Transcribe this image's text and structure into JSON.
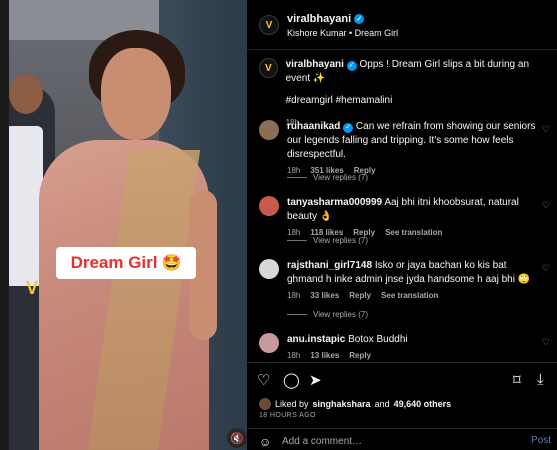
{
  "post": {
    "username": "viralbhayani",
    "audio": "Kishore Kumar • Dream Girl",
    "overlay_text": "Dream Girl",
    "overlay_emoji": "🤩"
  },
  "caption": {
    "username": "viralbhayani",
    "text": "Opps ! Dream Girl slips a bit during an event ✨",
    "hashtags": "#dreamgirl #hemamalini",
    "age": "18h"
  },
  "comments": [
    {
      "username": "ruhaanikad",
      "verified": true,
      "text": "Can we refrain from showing our seniors our legends falling and tripping. It's some how feels disrespectful.",
      "age": "18h",
      "likes": "351 likes",
      "reply": "Reply",
      "see_translation": "",
      "view_replies": "View replies (7)",
      "avatar_color": "#8b6e53"
    },
    {
      "username": "tanyasharma000999",
      "verified": false,
      "text": "Aaj bhi itni khoobsurat, natural beauty 👌",
      "age": "18h",
      "likes": "118 likes",
      "reply": "Reply",
      "see_translation": "See translation",
      "view_replies": "View replies (7)",
      "avatar_color": "#c65a4e"
    },
    {
      "username": "rajsthani_girl7148",
      "verified": false,
      "text": "Isko or jaya bachan ko kis bat ghmand h inke admin jnse jyda handsome h aaj bhi 🙄",
      "age": "18h",
      "likes": "33 likes",
      "reply": "Reply",
      "see_translation": "See translation",
      "view_replies": "View replies (7)",
      "avatar_color": "#d8d8dc"
    },
    {
      "username": "anu.instapic",
      "verified": false,
      "text": "Botox Buddhi",
      "age": "18h",
      "likes": "13 likes",
      "reply": "Reply",
      "see_translation": "",
      "view_replies": "",
      "avatar_color": "#c99a9a"
    }
  ],
  "engagement": {
    "liked_by_prefix": "Liked by",
    "liked_by_user": "singhakshara",
    "and": "and",
    "others": "49,640 others",
    "time": "18 HOURS AGO"
  },
  "composer": {
    "placeholder": "Add a comment…",
    "post_label": "Post"
  },
  "icons": {
    "like": "heart-icon",
    "comment": "comment-icon",
    "share": "share-icon",
    "save": "bookmark-icon",
    "emoji": "smile-icon",
    "mute": "speaker-muted-icon"
  }
}
